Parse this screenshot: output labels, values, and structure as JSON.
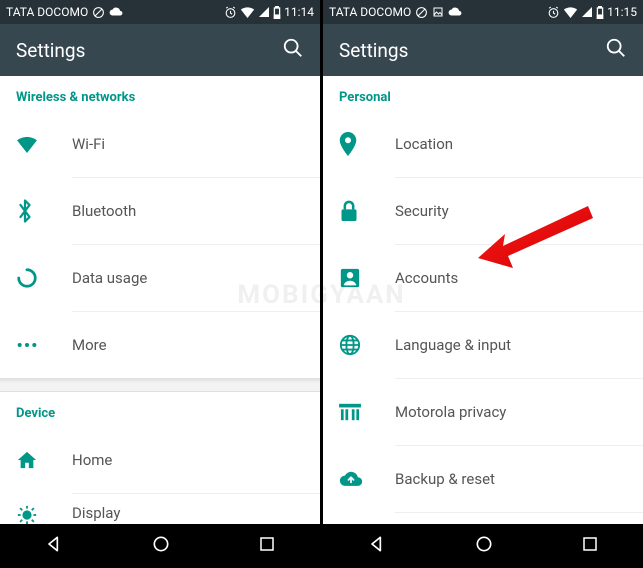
{
  "watermark": "MOBIGYAAN",
  "left": {
    "status": {
      "carrier": "TATA DOCOMO",
      "time": "11:14"
    },
    "appbar": {
      "title": "Settings"
    },
    "section_top": "Wireless & networks",
    "items_top": [
      {
        "label": "Wi-Fi",
        "icon": "wifi"
      },
      {
        "label": "Bluetooth",
        "icon": "bluetooth"
      },
      {
        "label": "Data usage",
        "icon": "data"
      },
      {
        "label": "More",
        "icon": "more"
      }
    ],
    "section_bottom": "Device",
    "items_bottom": [
      {
        "label": "Home",
        "icon": "home"
      }
    ],
    "cut_item": {
      "label": "Display",
      "icon": "display"
    }
  },
  "right": {
    "status": {
      "carrier": "TATA DOCOMO",
      "time": "11:15"
    },
    "appbar": {
      "title": "Settings"
    },
    "section": "Personal",
    "items": [
      {
        "label": "Location",
        "icon": "location"
      },
      {
        "label": "Security",
        "icon": "security"
      },
      {
        "label": "Accounts",
        "icon": "accounts"
      },
      {
        "label": "Language & input",
        "icon": "language"
      },
      {
        "label": "Motorola privacy",
        "icon": "privacy"
      },
      {
        "label": "Backup & reset",
        "icon": "backup"
      }
    ]
  }
}
